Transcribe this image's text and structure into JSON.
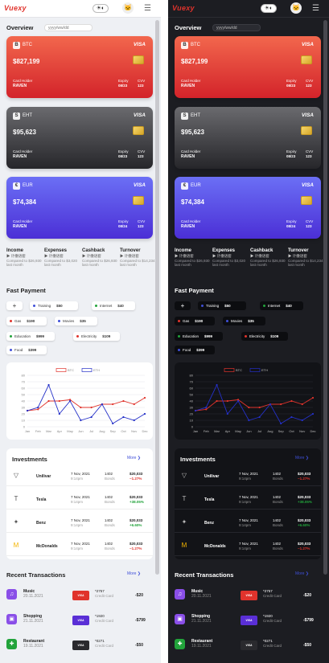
{
  "header": {
    "logo": "Vuexy",
    "avatar": "🐱",
    "menu": "☰",
    "theme_icons": "☀◐"
  },
  "overview": {
    "title": "Overview",
    "date_placeholder": "yyyy/ww/dd"
  },
  "cards": [
    {
      "code": "B",
      "currency": "BTC",
      "brand": "VISA",
      "amount": "$827,199",
      "holder_label": "Card Holder",
      "holder": "RAVEN",
      "expiry_label": "Expiry",
      "expiry": "08/23",
      "cvv_label": "CVV",
      "cvv": "123"
    },
    {
      "code": "S",
      "currency": "EHT",
      "brand": "VISA",
      "amount": "$95,623",
      "holder_label": "Card Holder",
      "holder": "RAVEN",
      "expiry_label": "Expiry",
      "expiry": "08/23",
      "cvv_label": "CVV",
      "cvv": "123"
    },
    {
      "code": "€",
      "currency": "EUR",
      "brand": "VISA",
      "amount": "$74,384",
      "holder_label": "Card Holder",
      "holder": "RAVEN",
      "expiry_label": "Expiry",
      "expiry": "08/24",
      "cvv_label": "CVV",
      "cvv": "123"
    }
  ],
  "stats": [
    {
      "title": "Income",
      "trend": "▶ 计缴语套",
      "note": "Compared to $26,930 last month"
    },
    {
      "title": "Expenses",
      "trend": "▶ 计缴语套",
      "note": "Compared to $3,020 last month"
    },
    {
      "title": "Cashback",
      "trend": "▶ 计缴语套",
      "note": "Compared to $26,930 last month"
    },
    {
      "title": "Turnover",
      "trend": "▶ 计缴语套",
      "note": "Compared to $14,234 last month"
    }
  ],
  "fast_payment": {
    "title": "Fast Payment",
    "add": "+",
    "items": [
      {
        "name": "Training",
        "amount": "$50",
        "color": "#3f4fd8"
      },
      {
        "name": "Internet",
        "amount": "$40",
        "color": "#22a33b"
      },
      {
        "name": "Gas",
        "amount": "$190",
        "color": "#e0332c"
      },
      {
        "name": "Movies",
        "amount": "$35",
        "color": "#3f4fd8"
      },
      {
        "name": "Education",
        "amount": "$999",
        "color": "#22a33b"
      },
      {
        "name": "Electricity",
        "amount": "$109",
        "color": "#e0332c"
      },
      {
        "name": "Food",
        "amount": "$399",
        "color": "#3f4fd8"
      }
    ]
  },
  "chart_data": {
    "type": "line",
    "title": "",
    "categories": [
      "Jan",
      "Feb",
      "Mar",
      "Apr",
      "May",
      "Jun",
      "Jul",
      "Aug",
      "Sep",
      "Oct",
      "Nov",
      "Dec"
    ],
    "series": [
      {
        "name": "BTC",
        "color": "#e0332c",
        "values": [
          25,
          27,
          40,
          40,
          42,
          30,
          30,
          35,
          35,
          40,
          35,
          45
        ]
      },
      {
        "name": "ETH",
        "color": "#2430c8",
        "values": [
          25,
          30,
          65,
          20,
          40,
          10,
          15,
          35,
          5,
          15,
          10,
          20
        ]
      }
    ],
    "ylim": [
      0,
      80
    ],
    "y_ticks": [
      "80",
      "70",
      "60",
      "50",
      "40",
      "30",
      "20",
      "10",
      "0"
    ],
    "grid": true,
    "legend": "top"
  },
  "investments": {
    "title": "Investments",
    "more": "More ❯",
    "rows": [
      {
        "icon": "▽",
        "name": "Unilivar",
        "date": "7 Nov, 2021",
        "time": "9:14pm",
        "qty": "1402",
        "qty_label": "Bonds",
        "price": "$20,033",
        "change": "−1.27%",
        "dir": "neg"
      },
      {
        "icon": "T",
        "name": "Tesla",
        "date": "7 Nov, 2021",
        "time": "9:14pm",
        "qty": "1402",
        "qty_label": "Bonds",
        "price": "$20,033",
        "change": "+38.05%",
        "dir": "pos"
      },
      {
        "icon": "✦",
        "name": "Benz",
        "date": "7 Nov, 2021",
        "time": "9:14pm",
        "qty": "1402",
        "qty_label": "Bonds",
        "price": "$20,033",
        "change": "+6.60%",
        "dir": "pos"
      },
      {
        "icon": "M",
        "name": "McDonalds",
        "date": "7 Nov, 2021",
        "time": "9:14pm",
        "qty": "1402",
        "qty_label": "Bonds",
        "price": "$20,033",
        "change": "−1.27%",
        "dir": "neg"
      }
    ]
  },
  "transactions": {
    "title": "Recent Transactions",
    "more": "More ❯",
    "rows": [
      {
        "icon": "♫",
        "icon_color": "#8a4fe8",
        "name": "Music",
        "date": "20.11.2021",
        "card": "VISA",
        "card_color": "#e0332c",
        "card_no": "*2757",
        "card_label": "Credit Card",
        "amount": "-$20"
      },
      {
        "icon": "▣",
        "icon_color": "#8a4fe8",
        "name": "Shopping",
        "date": "21.11.2021",
        "card": "VISA",
        "card_color": "#5a2fd6",
        "card_no": "*1920",
        "card_label": "Credit Card",
        "amount": "-$799"
      },
      {
        "icon": "✚",
        "icon_color": "#22a33b",
        "name": "Restaurant",
        "date": "19.11.2021",
        "card": "VISA",
        "card_color": "#2a2a2e",
        "card_no": "*0271",
        "card_label": "Credit Card",
        "amount": "-$50"
      }
    ]
  }
}
